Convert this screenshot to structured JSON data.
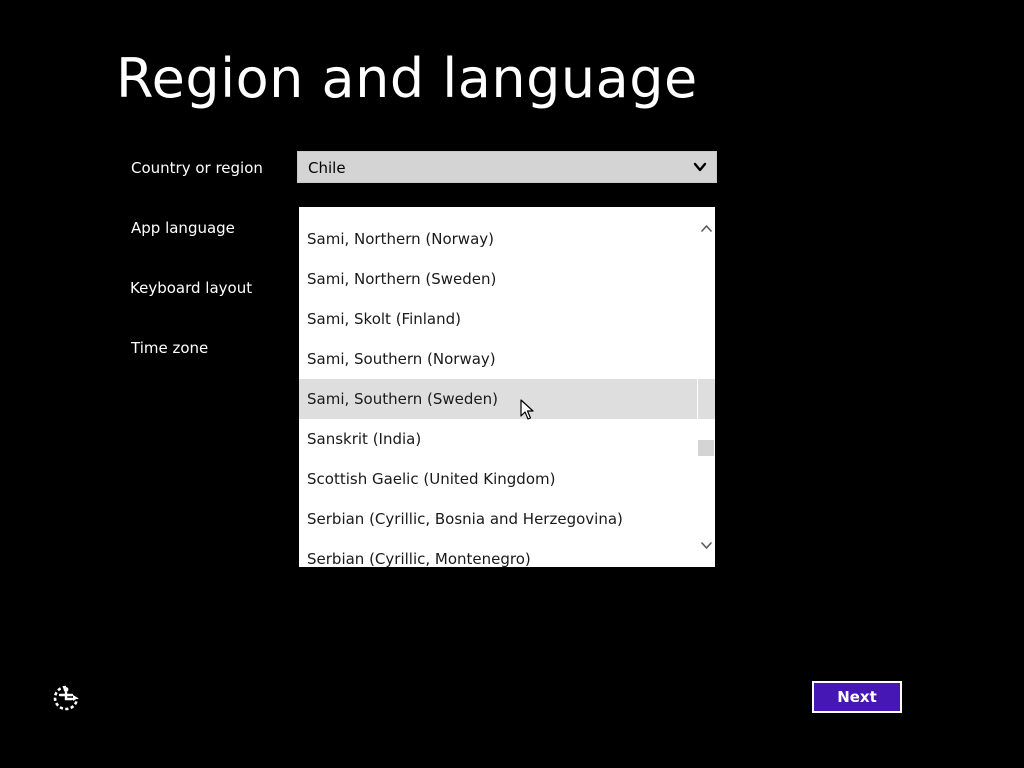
{
  "page": {
    "title": "Region and language"
  },
  "labels": {
    "country": "Country or region",
    "app_language": "App language",
    "keyboard_layout": "Keyboard layout",
    "time_zone": "Time zone"
  },
  "country_select": {
    "value": "Chile",
    "icon": "chevron-down-icon"
  },
  "app_language_list": {
    "items": [
      "Sami, Northern (Norway)",
      "Sami, Northern (Sweden)",
      "Sami, Skolt (Finland)",
      "Sami, Southern (Norway)",
      "Sami, Southern (Sweden)",
      "Sanskrit (India)",
      "Scottish Gaelic (United Kingdom)",
      "Serbian (Cyrillic, Bosnia and Herzegovina)",
      "Serbian (Cyrillic, Montenegro)"
    ],
    "hovered_item": "Sami, Southern (Sweden)"
  },
  "footer": {
    "ease_of_access_icon": "ease-of-access-icon",
    "next_label": "Next"
  },
  "colors": {
    "background": "#000000",
    "accent": "#4617b4",
    "select_bg": "#d4d4d4",
    "list_hover": "#dedede"
  }
}
